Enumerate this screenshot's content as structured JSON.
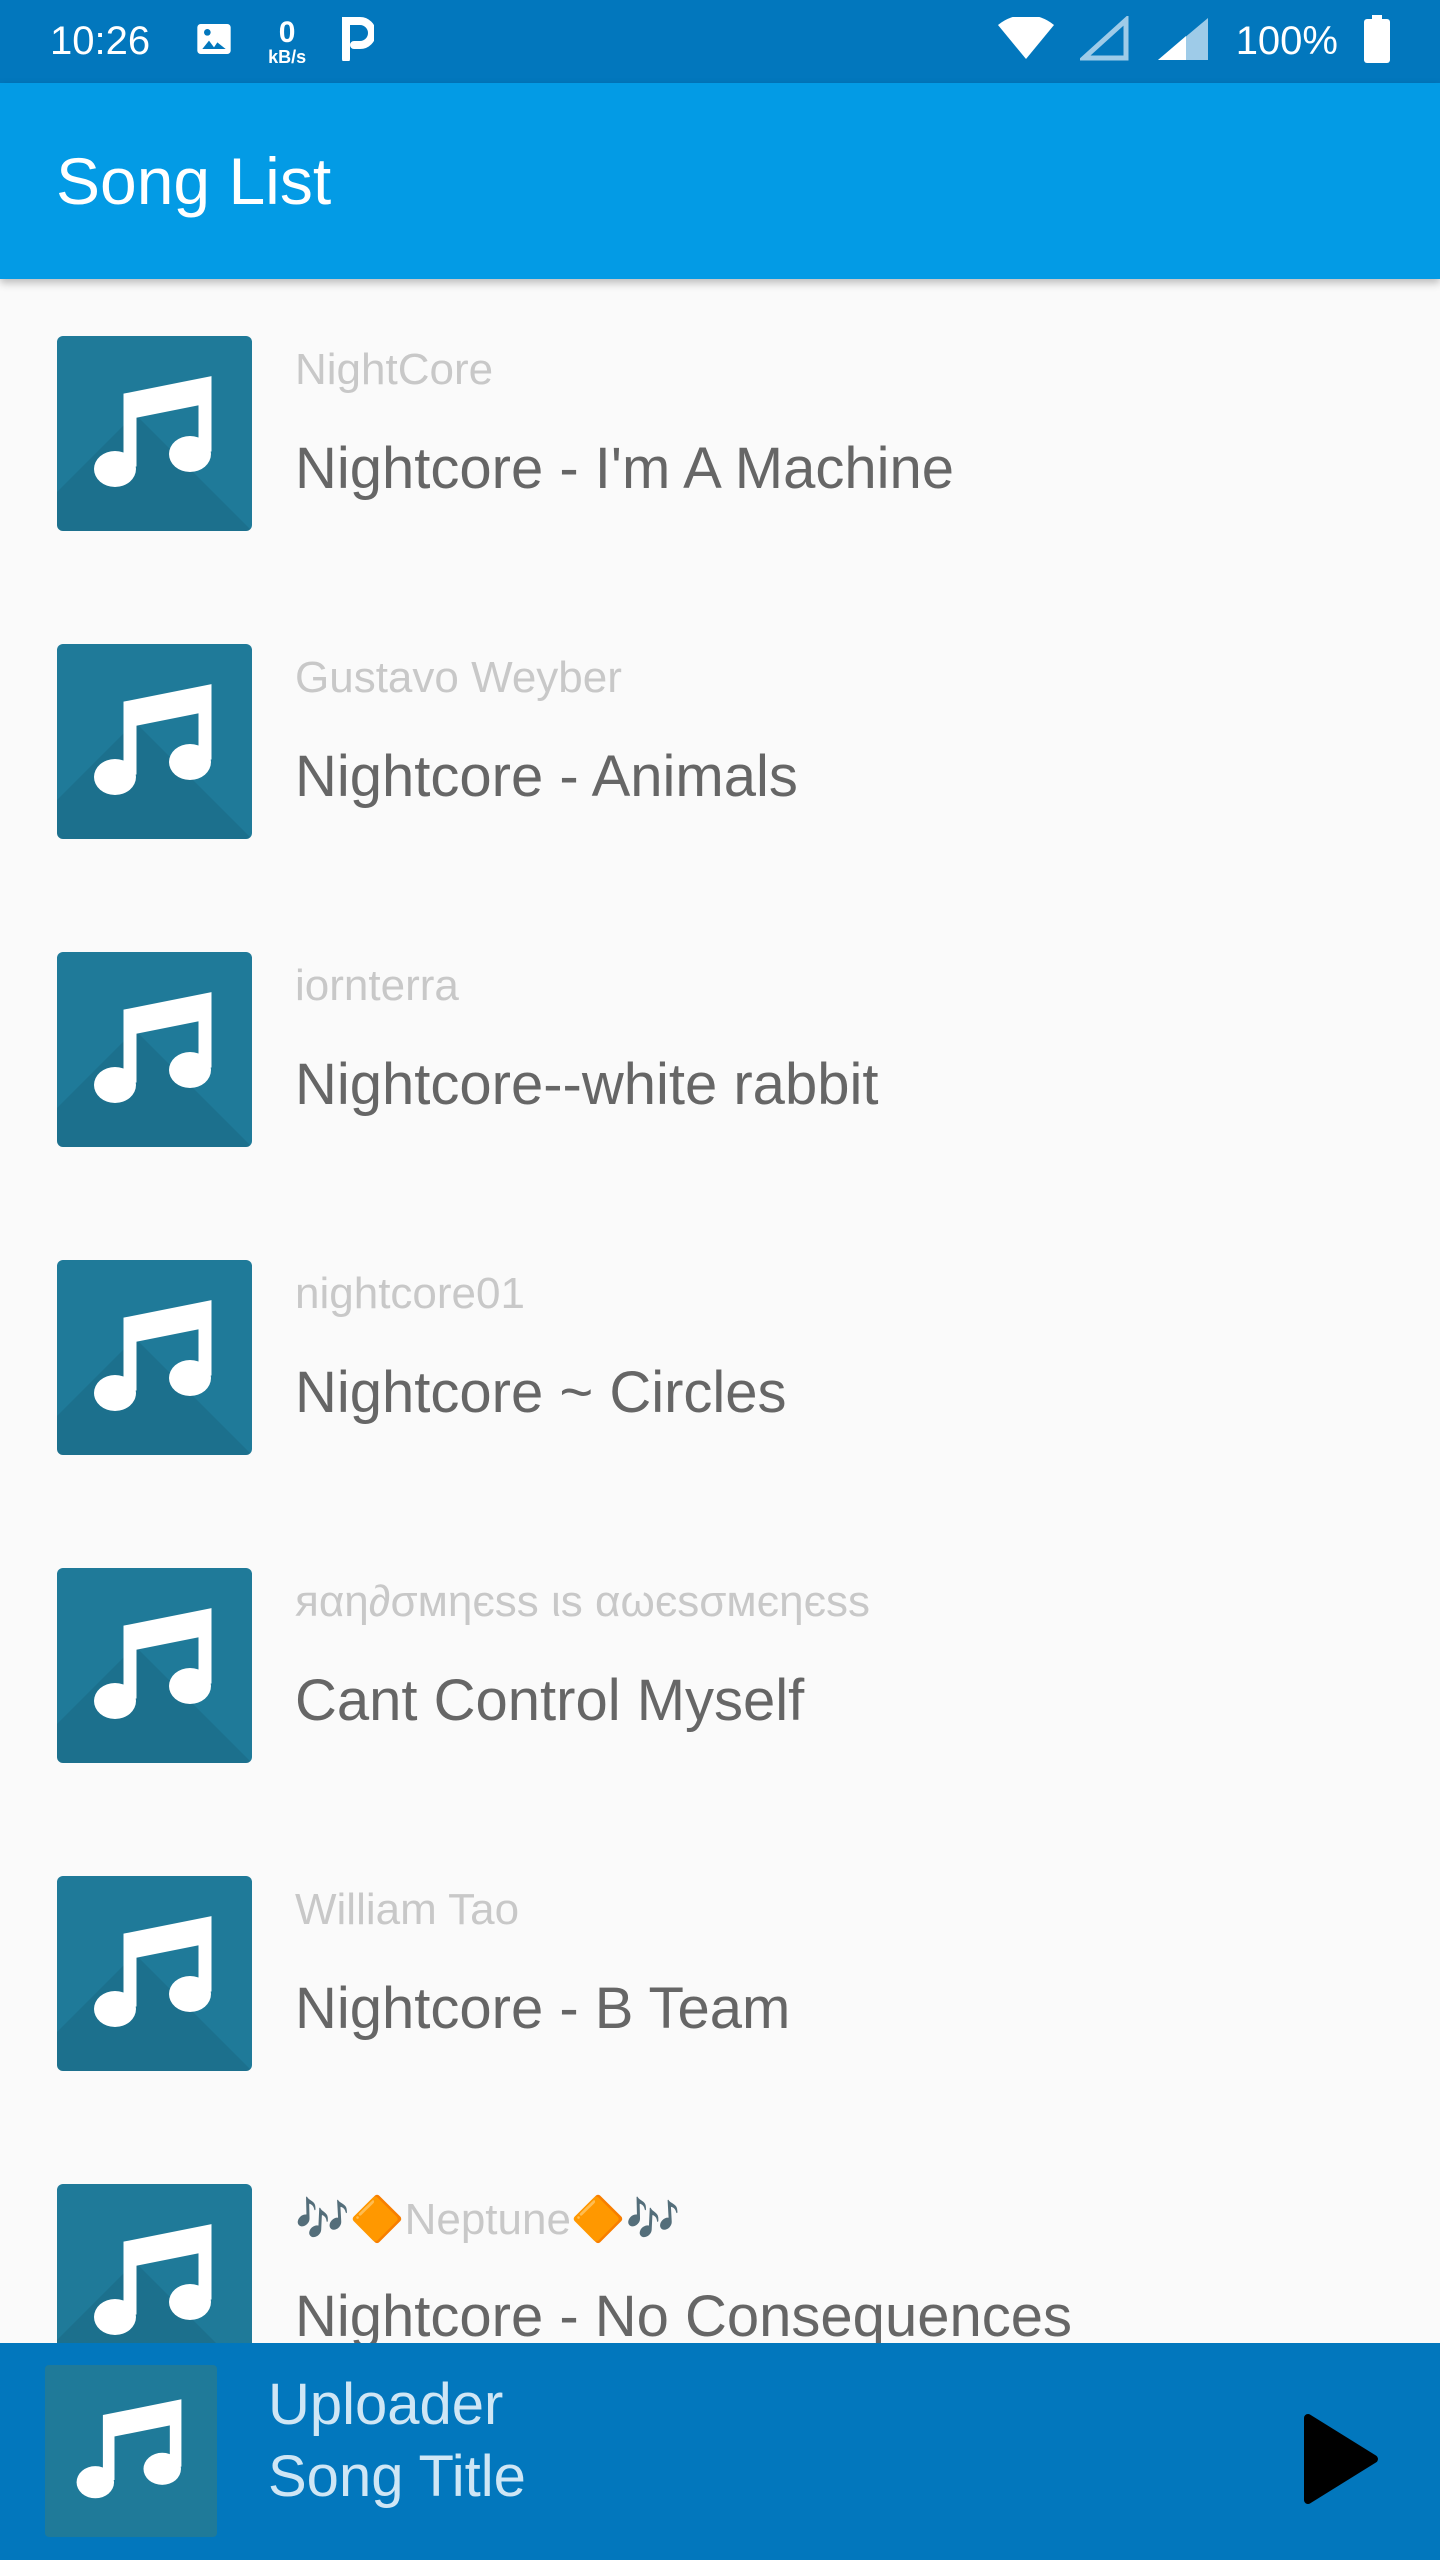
{
  "status_bar": {
    "time": "10:26",
    "network_speed_value": "0",
    "network_speed_unit": "kB/s",
    "battery": "100%",
    "icons": [
      "image-icon",
      "parking-icon",
      "wifi-icon",
      "signal-icon",
      "battery-icon"
    ]
  },
  "app_bar": {
    "title": "Song List"
  },
  "songs": [
    {
      "uploader": "NightCore",
      "title": "Nightcore - I'm A Machine"
    },
    {
      "uploader": "Gustavo Weyber",
      "title": "Nightcore - Animals"
    },
    {
      "uploader": "iornterra",
      "title": "Nightcore--white rabbit"
    },
    {
      "uploader": "nightcore01",
      "title": "Nightcore ~ Circles"
    },
    {
      "uploader": "яαη∂σмηєѕѕ ιѕ αωєѕσмєηєѕѕ",
      "title": "Cant Control Myself"
    },
    {
      "uploader": "William Tao",
      "title": "Nightcore - B Team"
    },
    {
      "uploader": "🎶🔶Neptune🔶🎶",
      "title": "Nightcore - No Consequences"
    }
  ],
  "player": {
    "uploader": "Uploader",
    "title": "Song Title",
    "play_icon": "play-icon"
  },
  "colors": {
    "status_bar": "#0277bd",
    "app_bar": "#039be5",
    "thumb": "#1f7a99",
    "player": "#0277bd"
  }
}
